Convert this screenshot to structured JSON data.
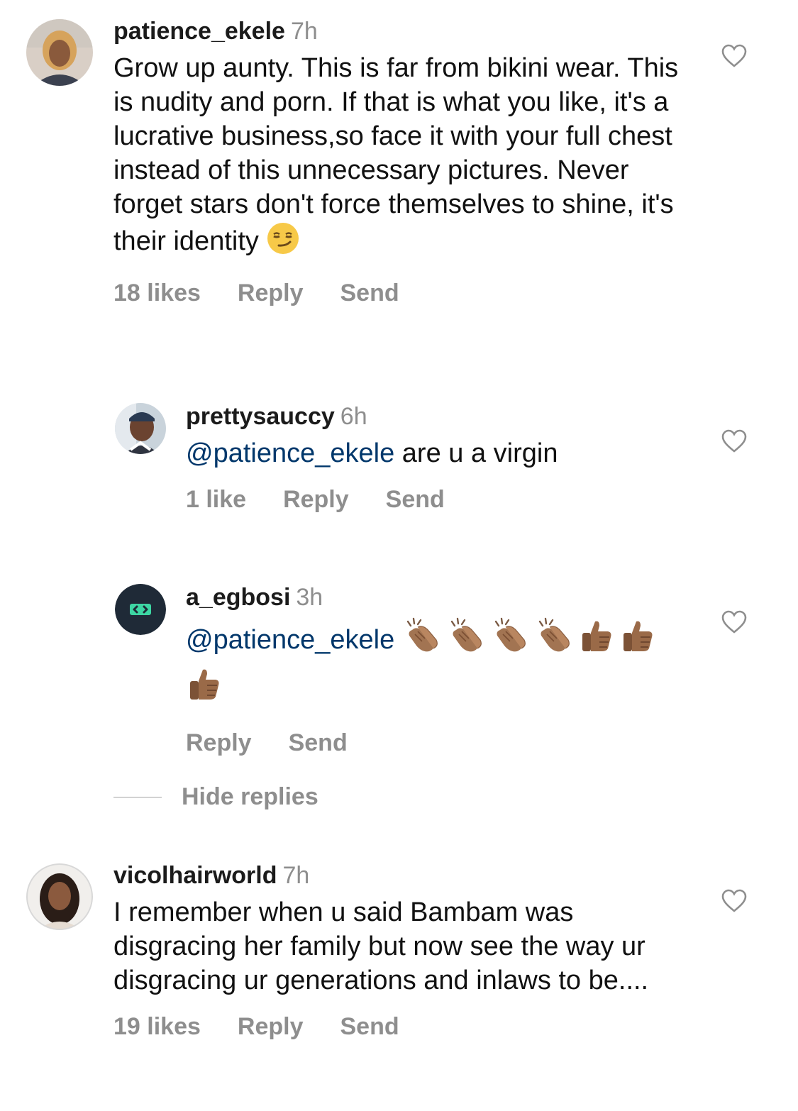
{
  "comments": [
    {
      "username": "patience_ekele",
      "time": "7h",
      "text": "Grow up aunty. This is far from bikini wear. This is nudity and porn. If that is what you like, it's a lucrative business,so face it with your full chest instead of this unnecessary pictures. Never forget stars don't force themselves to shine, it's their identity",
      "emoji": "smirking-face",
      "likes": "18 likes",
      "reply": "Reply",
      "send": "Send"
    },
    {
      "username": "vicolhairworld",
      "time": "7h",
      "text": "I remember when u said Bambam was disgracing her family but now  see the way ur disgracing ur generations and inlaws to be....",
      "likes": "19 likes",
      "reply": "Reply",
      "send": "Send"
    }
  ],
  "replies": [
    {
      "username": "prettysauccy",
      "time": "6h",
      "mention": "@patience_ekele",
      "text": " are u a virgin",
      "likes": "1 like",
      "reply": "Reply",
      "send": "Send"
    },
    {
      "username": "a_egbosi",
      "time": "3h",
      "mention": "@patience_ekele",
      "emojis": [
        "clapping-hands",
        "clapping-hands",
        "clapping-hands",
        "clapping-hands",
        "thumbs-up",
        "thumbs-up",
        "thumbs-up"
      ],
      "reply": "Reply",
      "send": "Send"
    }
  ],
  "hide_replies": "Hide replies",
  "colors": {
    "mention": "#00376b",
    "secondary": "#8e8e8e",
    "avatar_dark": "#1f2a37",
    "avatar_logo": "#3dd6a3"
  }
}
